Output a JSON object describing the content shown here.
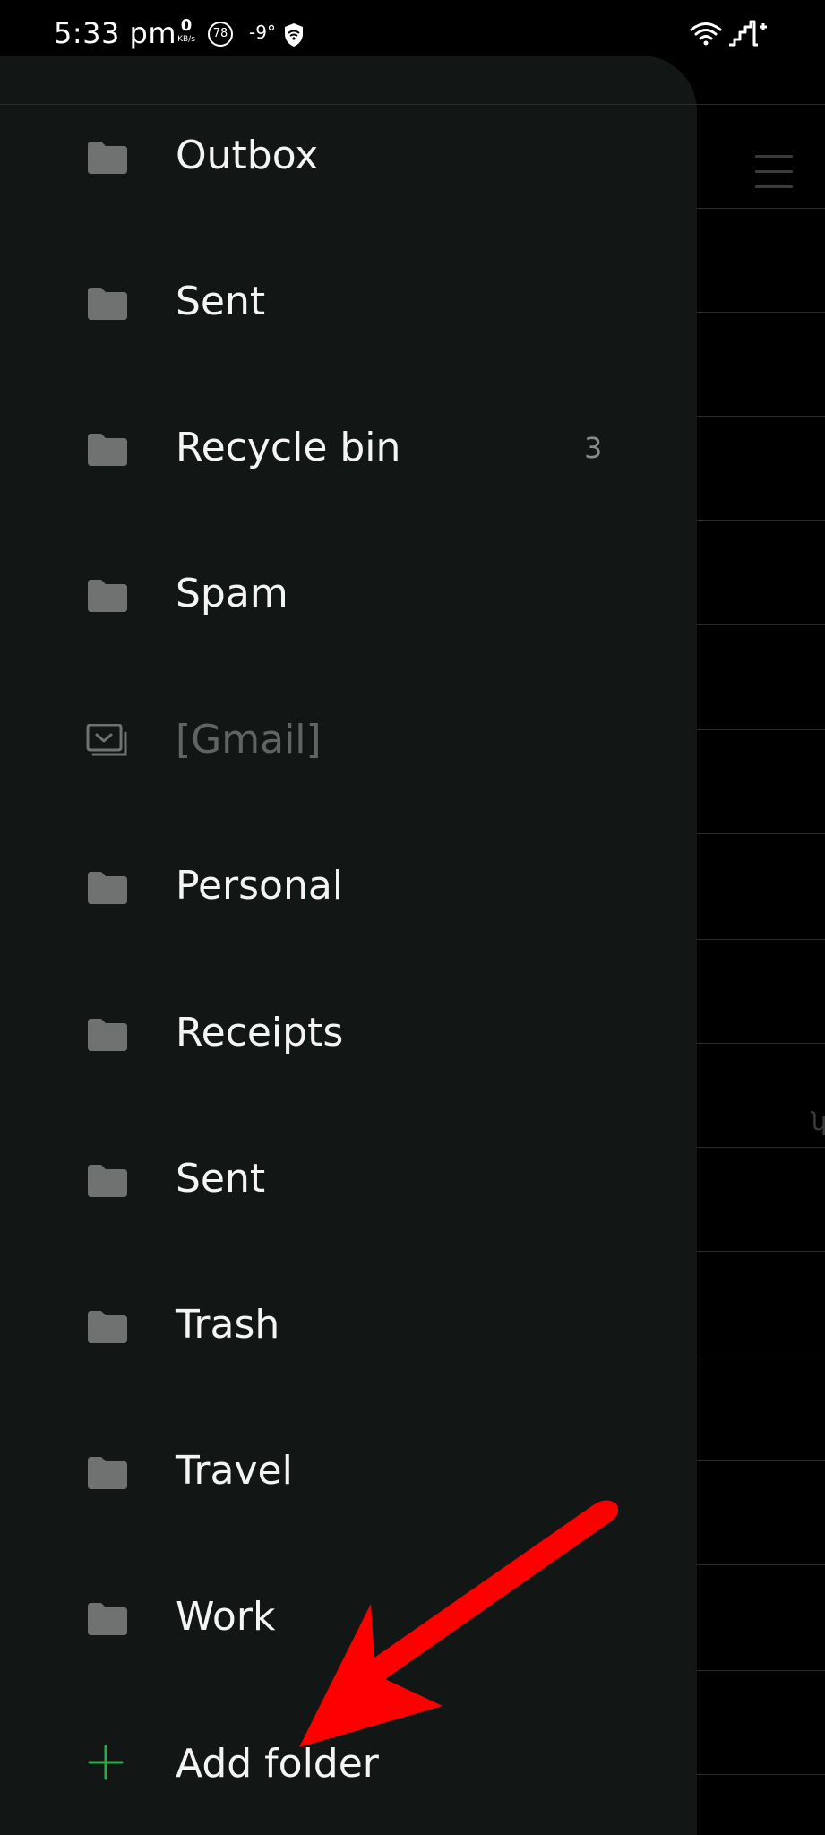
{
  "status_bar": {
    "time": "5:33 pm",
    "net_speed_value": "0",
    "net_speed_unit": "KB/s",
    "battery": "78",
    "temperature": "-9°",
    "icons": [
      "shield-icon",
      "wifi-icon",
      "signal-icon"
    ]
  },
  "drawer": {
    "folders": [
      {
        "label": "Outbox",
        "count": "",
        "icon": "folder-icon",
        "muted": false
      },
      {
        "label": "Sent",
        "count": "",
        "icon": "folder-icon",
        "muted": false
      },
      {
        "label": "Recycle bin",
        "count": "3",
        "icon": "folder-icon",
        "muted": false
      },
      {
        "label": "Spam",
        "count": "",
        "icon": "folder-icon",
        "muted": false
      },
      {
        "label": "[Gmail]",
        "count": "",
        "icon": "folder-group-icon",
        "muted": true
      },
      {
        "label": "Personal",
        "count": "",
        "icon": "folder-icon",
        "muted": false
      },
      {
        "label": "Receipts",
        "count": "",
        "icon": "folder-icon",
        "muted": false
      },
      {
        "label": "Sent",
        "count": "",
        "icon": "folder-icon",
        "muted": false
      },
      {
        "label": "Trash",
        "count": "",
        "icon": "folder-icon",
        "muted": false
      },
      {
        "label": "Travel",
        "count": "",
        "icon": "folder-icon",
        "muted": false
      },
      {
        "label": "Work",
        "count": "",
        "icon": "folder-icon",
        "muted": false
      }
    ],
    "add_folder": {
      "label": "Add folder",
      "icon": "plus-icon"
    }
  },
  "background": {
    "menu_icon": "menu-icon"
  },
  "annotation": {
    "icon": "red-arrow-icon"
  },
  "colors": {
    "drawer_bg": "#121614",
    "folder_icon": "#6f7270",
    "accent_green": "#2fa84f",
    "arrow_red": "#ff0000"
  }
}
